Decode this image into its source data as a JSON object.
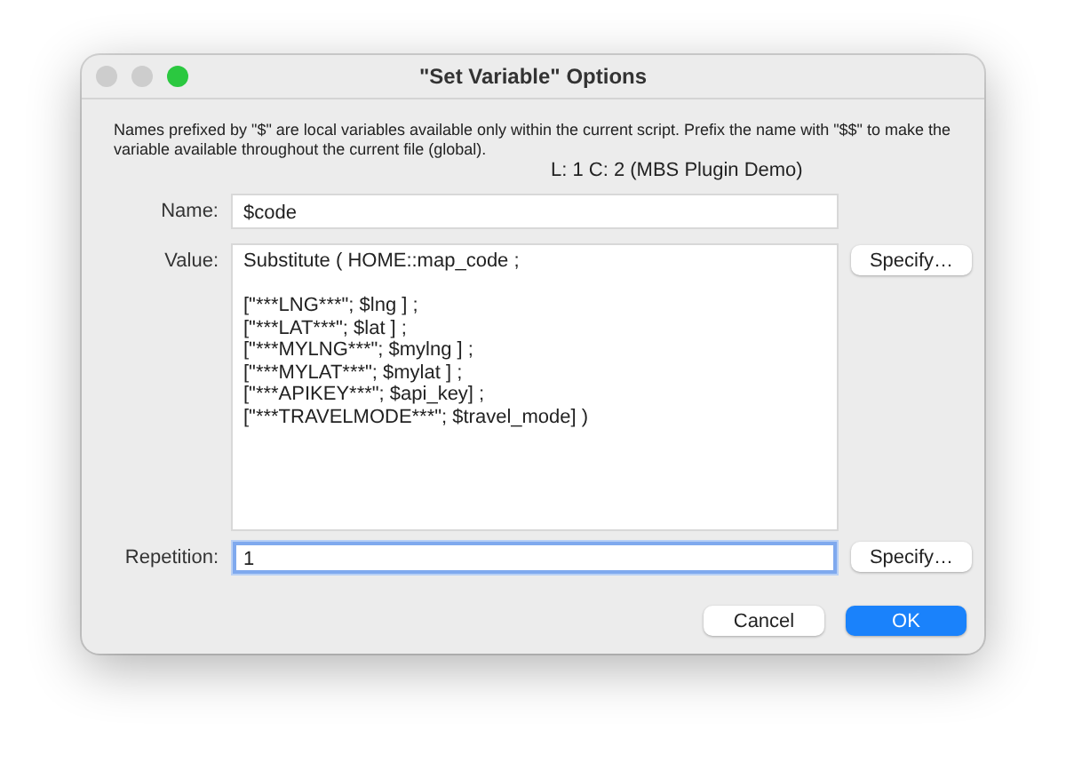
{
  "window": {
    "title": "\"Set Variable\" Options"
  },
  "note": "Names prefixed by \"$\" are local variables available only within the current script. Prefix the name with \"$$\" to make the variable available throughout the current file (global).",
  "status": "L: 1 C: 2 (MBS Plugin Demo)",
  "fields": [
    {
      "kind": "line",
      "label": "Name:",
      "value": "$code",
      "focused": false
    },
    {
      "kind": "area",
      "label": "Value:",
      "value": "Substitute ( HOME::map_code ;\n\n[\"***LNG***\"; $lng ] ;\n[\"***LAT***\"; $lat ] ;\n[\"***MYLNG***\"; $mylng ] ;\n[\"***MYLAT***\"; $mylat ] ;\n[\"***APIKEY***\"; $api_key] ;\n[\"***TRAVELMODE***\"; $travel_mode] )",
      "button": "Specify…",
      "focused": false
    },
    {
      "kind": "line",
      "label": "Repetition:",
      "value": "1",
      "button": "Specify…",
      "focused": true
    }
  ],
  "buttons": [
    {
      "label": "Cancel",
      "default": false
    },
    {
      "label": "OK",
      "default": true
    }
  ]
}
